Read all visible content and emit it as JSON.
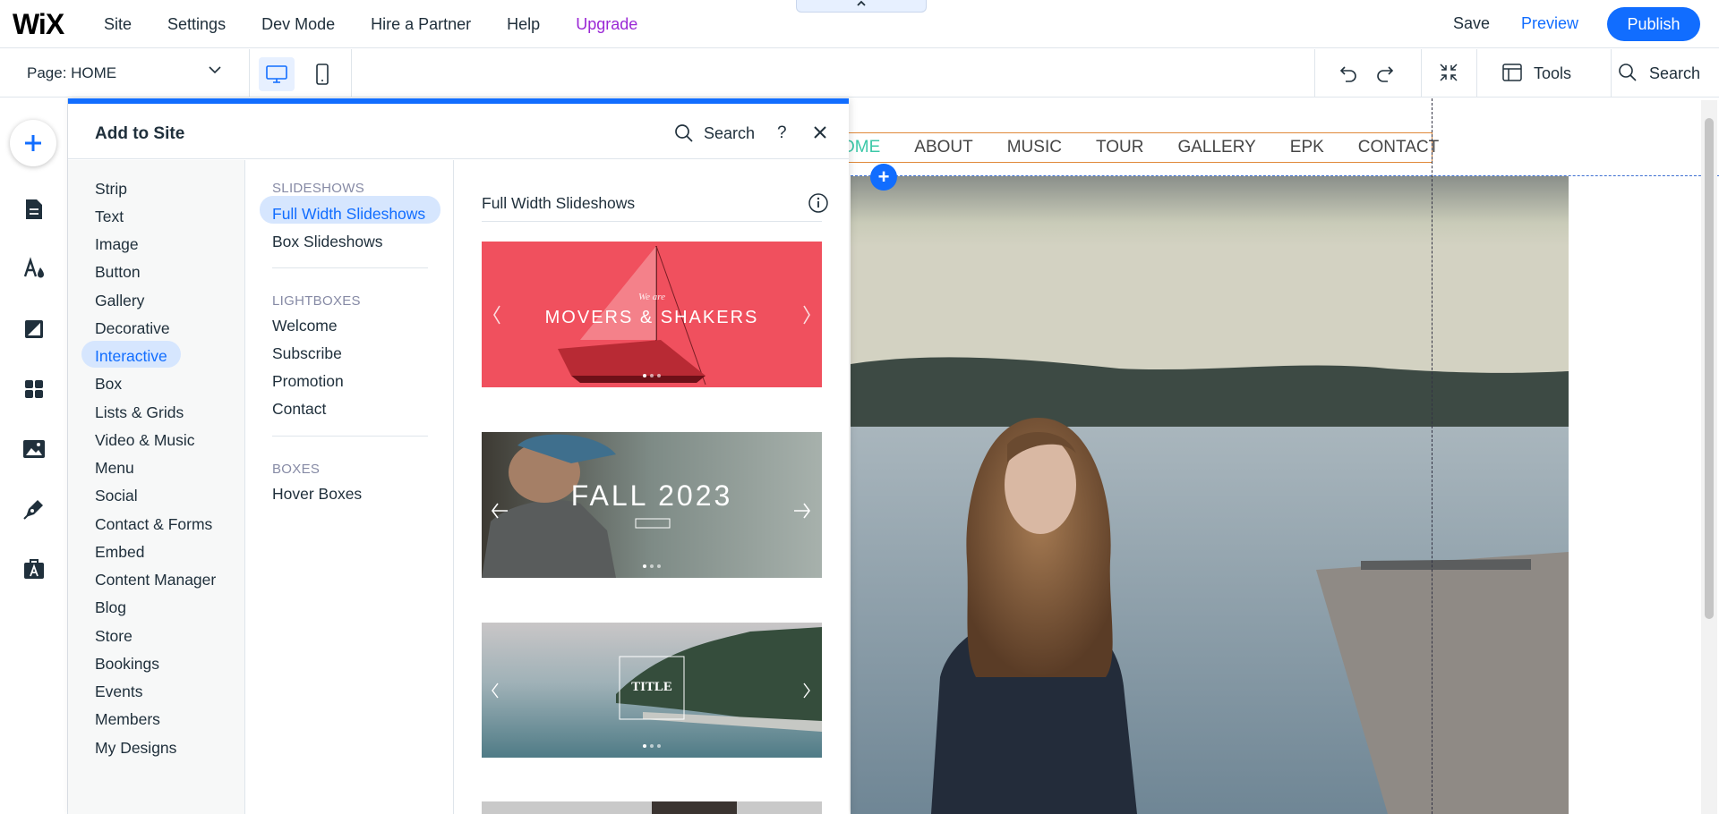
{
  "topbar": {
    "logo": "WiX",
    "menu": [
      "Site",
      "Settings",
      "Dev Mode",
      "Hire a Partner",
      "Help",
      "Upgrade"
    ],
    "pull_tab": "^",
    "save": "Save",
    "preview": "Preview",
    "publish": "Publish"
  },
  "toolbar": {
    "page_label": "Page: HOME",
    "tools": "Tools",
    "search": "Search"
  },
  "panel": {
    "title": "Add to Site",
    "search": "Search",
    "help": "?",
    "categories": [
      "Strip",
      "Text",
      "Image",
      "Button",
      "Gallery",
      "Decorative",
      "Interactive",
      "Box",
      "Lists & Grids",
      "Video & Music",
      "Menu",
      "Social",
      "Contact & Forms",
      "Embed",
      "Content Manager",
      "Blog",
      "Store",
      "Bookings",
      "Events",
      "Members",
      "My Designs"
    ],
    "selected_category": "Interactive",
    "sections": [
      {
        "heading": "SLIDESHOWS",
        "items": [
          "Full Width Slideshows",
          "Box Slideshows"
        ]
      },
      {
        "heading": "LIGHTBOXES",
        "items": [
          "Welcome",
          "Subscribe",
          "Promotion",
          "Contact"
        ]
      },
      {
        "heading": "BOXES",
        "items": [
          "Hover Boxes"
        ]
      }
    ],
    "selected_item": "Full Width Slideshows",
    "preview_title": "Full Width Slideshows",
    "thumbs": [
      {
        "small": "We are",
        "big": "MOVERS & SHAKERS"
      },
      {
        "big": "FALL 2023"
      },
      {
        "big": "TITLE"
      }
    ]
  },
  "site": {
    "nav": [
      "OME",
      "ABOUT",
      "MUSIC",
      "TOUR",
      "GALLERY",
      "EPK",
      "CONTACT"
    ],
    "add_button": "+"
  },
  "colors": {
    "accent": "#116dff",
    "upgrade": "#9a27d5",
    "selection": "#d6e6fe",
    "nav_active": "#3cc8a8"
  }
}
